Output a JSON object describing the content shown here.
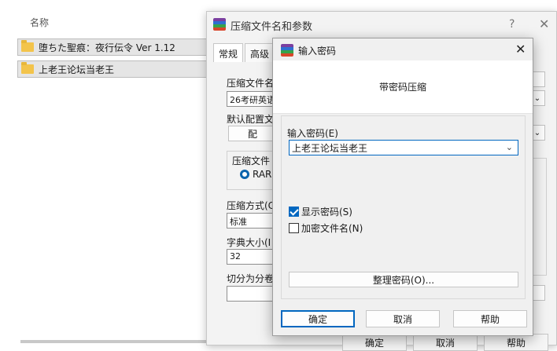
{
  "explorer": {
    "column_name": "名称",
    "files": [
      {
        "name": "堕ちた聖痕：夜行伝令 Ver 1.12",
        "icon": "folder-icon"
      },
      {
        "name": "上老王论坛当老王",
        "icon": "folder-icon"
      }
    ]
  },
  "back_dialog": {
    "title": "压缩文件名和参数",
    "help": "?",
    "close": "✕",
    "tabs": [
      "常规",
      "高级"
    ],
    "archive_name_label": "压缩文件名",
    "archive_name_value": "26考研英语",
    "profile_label": "默认配置文",
    "profile_button": "配",
    "format_group": "压缩文件",
    "format_rar": "RAR",
    "method_label": "压缩方式(C",
    "method_value": "标准",
    "dict_label": "字典大小(I",
    "dict_value": "32",
    "split_label": "切分为分卷",
    "ok": "确定",
    "cancel": "取消",
    "help_btn": "帮助"
  },
  "front_dialog": {
    "title": "输入密码",
    "close": "✕",
    "header": "带密码压缩",
    "password_label": "输入密码(E)",
    "password_value": "上老王论坛当老王",
    "show_password": "显示密码(S)",
    "show_password_checked": true,
    "encrypt_names": "加密文件名(N)",
    "encrypt_names_checked": false,
    "organize_button": "整理密码(O)...",
    "ok": "确定",
    "cancel": "取消",
    "help": "帮助",
    "accent": "#0067c0"
  }
}
